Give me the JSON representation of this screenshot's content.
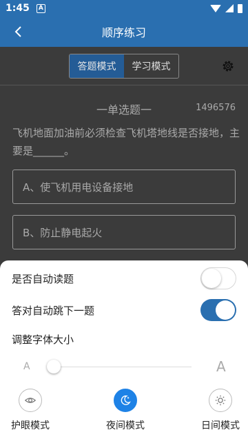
{
  "status_bar": {
    "time": "1:45",
    "notif_letter": "A"
  },
  "header": {
    "title": "顺序练习"
  },
  "mode_tabs": [
    {
      "label": "答题模式",
      "active": true
    },
    {
      "label": "学习模式",
      "active": false
    }
  ],
  "question": {
    "type": "一单选题一",
    "number": "1496576",
    "text": "飞机地面加油前必须检查飞机塔地线是否接地，主要是______。",
    "options": [
      {
        "label": "A、使飞机用电设备接地"
      },
      {
        "label": "B、防止静电起火"
      }
    ]
  },
  "settings": {
    "auto_read": {
      "label": "是否自动读题",
      "on": false
    },
    "auto_next": {
      "label": "答对自动跳下一题",
      "on": true
    },
    "font_size": {
      "label": "调整字体大小",
      "small_label": "A",
      "large_label": "A",
      "level": 0
    }
  },
  "themes": [
    {
      "label": "护眼模式",
      "icon": "eye-icon",
      "active": false
    },
    {
      "label": "夜间模式",
      "icon": "moon-icon",
      "active": true
    },
    {
      "label": "日间模式",
      "icon": "sun-icon",
      "active": false
    }
  ],
  "colors": {
    "primary": "#2a6fb0",
    "active_theme": "#1e82e6",
    "overlay": "#3b3b3b"
  }
}
